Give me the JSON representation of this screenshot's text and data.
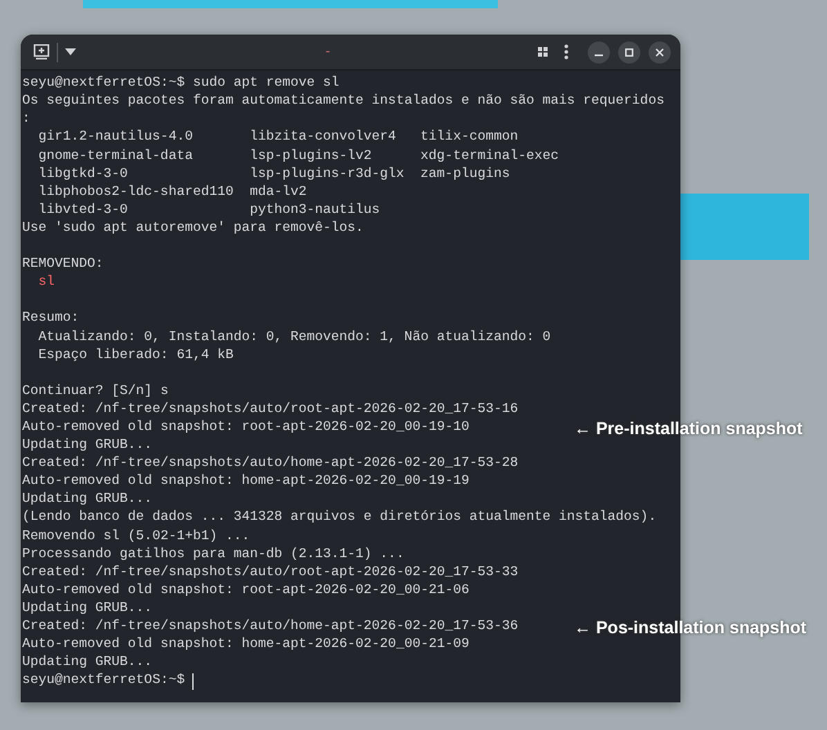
{
  "titlebar": {
    "tab_mark": "-"
  },
  "terminal": {
    "lines": [
      {
        "kind": "prompt",
        "prompt": "seyu@nextferretOS:~$",
        "command": "sudo apt remove sl"
      },
      {
        "kind": "text",
        "text": "Os seguintes pacotes foram automaticamente instalados e não são mais requeridos"
      },
      {
        "kind": "text",
        "text": ":"
      },
      {
        "kind": "packages",
        "cells": [
          "gir1.2-nautilus-4.0",
          "libzita-convolver4",
          "tilix-common"
        ]
      },
      {
        "kind": "packages",
        "cells": [
          "gnome-terminal-data",
          "lsp-plugins-lv2",
          "xdg-terminal-exec"
        ]
      },
      {
        "kind": "packages",
        "cells": [
          "libgtkd-3-0",
          "lsp-plugins-r3d-glx",
          "zam-plugins"
        ]
      },
      {
        "kind": "packages",
        "cells": [
          "libphobos2-ldc-shared110",
          "mda-lv2"
        ]
      },
      {
        "kind": "packages",
        "cells": [
          "libvted-3-0",
          "python3-nautilus"
        ]
      },
      {
        "kind": "text",
        "text": "Use 'sudo apt autoremove' para removê-los."
      },
      {
        "kind": "blank"
      },
      {
        "kind": "text",
        "text": "REMOVENDO:"
      },
      {
        "kind": "removed",
        "text": "sl"
      },
      {
        "kind": "blank"
      },
      {
        "kind": "text",
        "text": "Resumo:"
      },
      {
        "kind": "indented",
        "text": "Atualizando: 0, Instalando: 0, Removendo: 1, Não atualizando: 0"
      },
      {
        "kind": "indented",
        "text": "Espaço liberado: 61,4 kB"
      },
      {
        "kind": "blank"
      },
      {
        "kind": "text",
        "text": "Continuar? [S/n] s"
      },
      {
        "kind": "text",
        "text": "Created: /nf-tree/snapshots/auto/root-apt-2026-02-20_17-53-16"
      },
      {
        "kind": "text",
        "text": "Auto-removed old snapshot: root-apt-2026-02-20_00-19-10",
        "annotation": "← Pre-installation snapshot"
      },
      {
        "kind": "text",
        "text": "Updating GRUB..."
      },
      {
        "kind": "text",
        "text": "Created: /nf-tree/snapshots/auto/home-apt-2026-02-20_17-53-28"
      },
      {
        "kind": "text",
        "text": "Auto-removed old snapshot: home-apt-2026-02-20_00-19-19"
      },
      {
        "kind": "text",
        "text": "Updating GRUB..."
      },
      {
        "kind": "text",
        "text": "(Lendo banco de dados ... 341328 arquivos e diretórios atualmente instalados)."
      },
      {
        "kind": "text",
        "text": "Removendo sl (5.02-1+b1) ..."
      },
      {
        "kind": "text",
        "text": "Processando gatilhos para man-db (2.13.1-1) ..."
      },
      {
        "kind": "text",
        "text": "Created: /nf-tree/snapshots/auto/root-apt-2026-02-20_17-53-33"
      },
      {
        "kind": "text",
        "text": "Auto-removed old snapshot: root-apt-2026-02-20_00-21-06"
      },
      {
        "kind": "text",
        "text": "Updating GRUB..."
      },
      {
        "kind": "text",
        "text": "Created: /nf-tree/snapshots/auto/home-apt-2026-02-20_17-53-36",
        "annotation": "← Pos-installation snapshot"
      },
      {
        "kind": "text",
        "text": "Auto-removed old snapshot: home-apt-2026-02-20_00-21-09"
      },
      {
        "kind": "text",
        "text": "Updating GRUB..."
      },
      {
        "kind": "prompt",
        "prompt": "seyu@nextferretOS:~$",
        "cursor": true
      }
    ]
  }
}
